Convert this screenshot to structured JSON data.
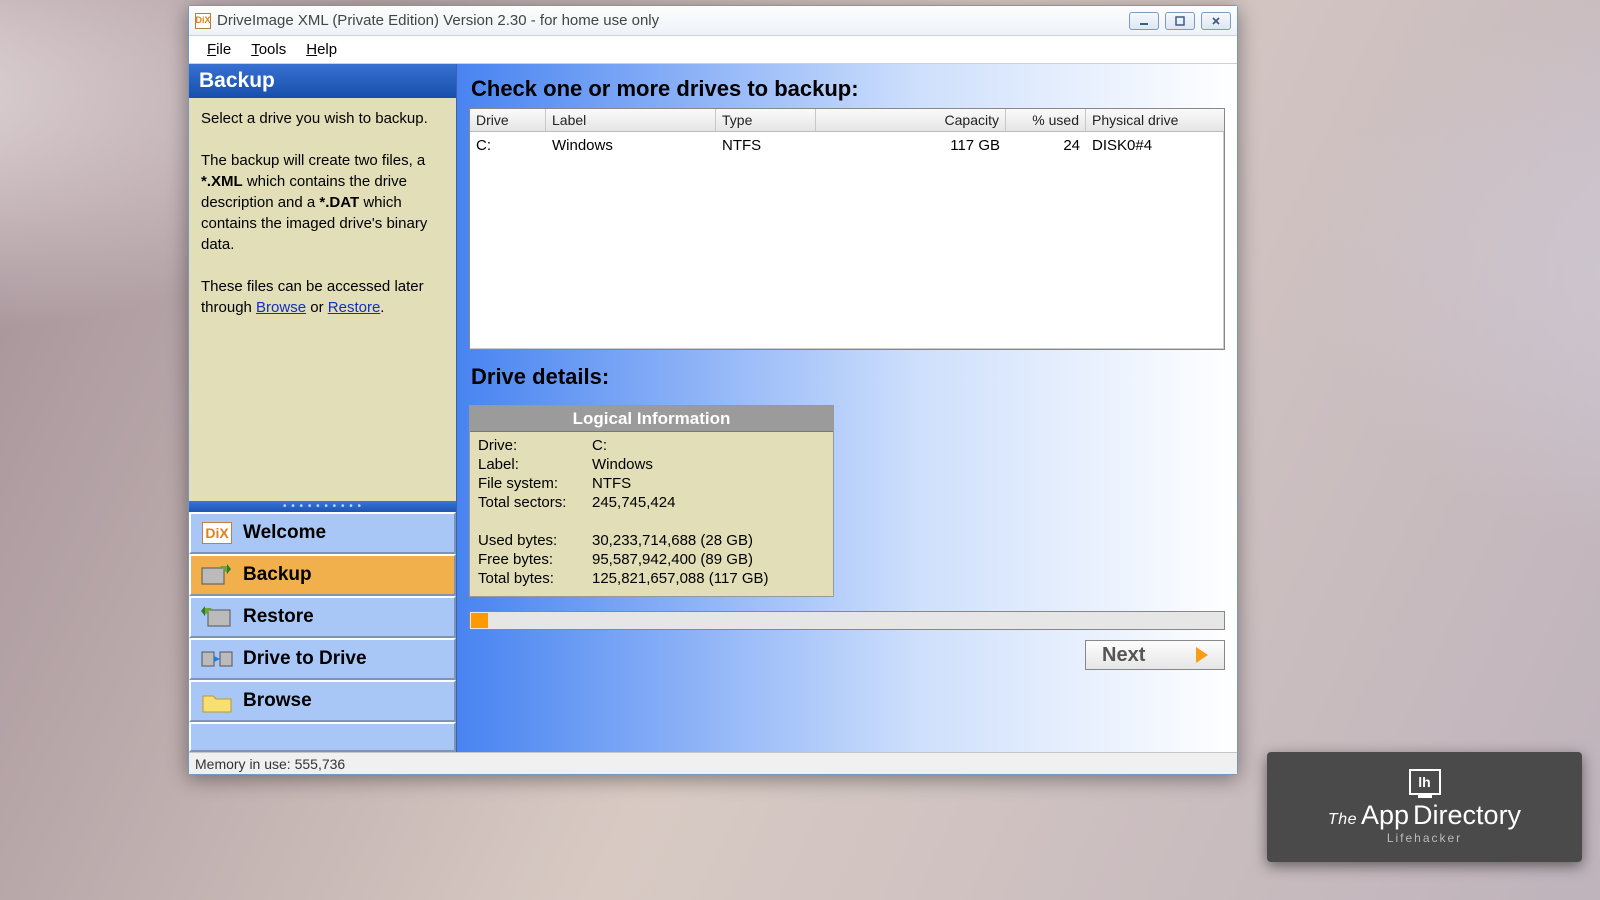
{
  "window": {
    "title": "DriveImage XML (Private Edition) Version 2.30 - for home use only"
  },
  "menu": {
    "file": "File",
    "tools": "Tools",
    "help": "Help"
  },
  "sidebar": {
    "header": "Backup",
    "p1": "Select a drive you wish to backup.",
    "p2a": "The backup will create two files, a ",
    "p2b": " which contains the drive description and a ",
    "p2c": " which contains the imaged drive's binary data.",
    "xml": "*.XML",
    "dat": "*.DAT",
    "p3a": "These files can be accessed later through ",
    "browse": "Browse",
    "or": " or ",
    "restore": "Restore",
    "dot": ".",
    "nav": {
      "welcome": "Welcome",
      "backup": "Backup",
      "restore": "Restore",
      "d2d": "Drive to Drive",
      "browse": "Browse"
    }
  },
  "main": {
    "title1": "Check one or more drives to backup:",
    "cols": {
      "drive": "Drive",
      "label": "Label",
      "type": "Type",
      "capacity": "Capacity",
      "used": "% used",
      "phys": "Physical drive"
    },
    "rows": [
      {
        "drive": "C:",
        "label": "Windows",
        "type": "NTFS",
        "capacity": "117 GB",
        "used": "24",
        "phys": "DISK0#4"
      }
    ],
    "title2": "Drive details:",
    "details_header": "Logical Information",
    "details": {
      "l_drive": "Drive:",
      "v_drive": "C:",
      "l_label": "Label:",
      "v_label": "Windows",
      "l_fs": "File system:",
      "v_fs": "NTFS",
      "l_sectors": "Total sectors:",
      "v_sectors": "245,745,424",
      "l_used": "Used bytes:",
      "v_used": "30,233,714,688 (28 GB)",
      "l_free": "Free bytes:",
      "v_free": "95,587,942,400 (89 GB)",
      "l_total": "Total bytes:",
      "v_total": "125,821,657,088 (117 GB)"
    },
    "next": "Next"
  },
  "status": "Memory in use: 555,736",
  "watermark": {
    "the": "The",
    "app": "App",
    "dir": "Directory",
    "sub": "Lifehacker"
  }
}
